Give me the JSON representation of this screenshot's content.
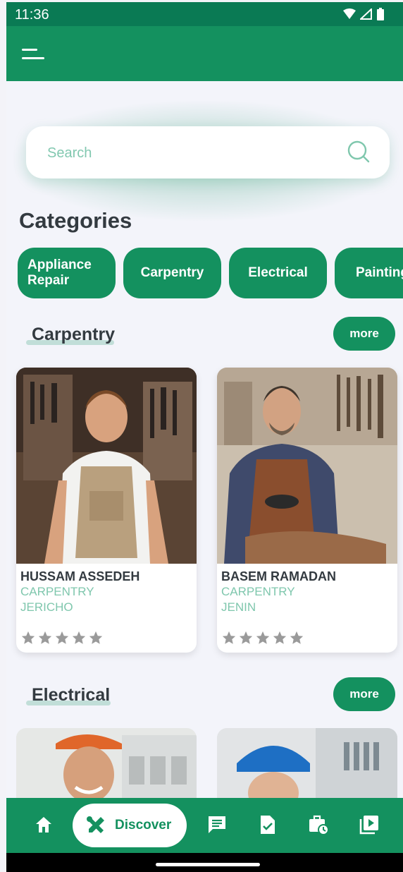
{
  "status": {
    "time": "11:36"
  },
  "search": {
    "placeholder": "Search"
  },
  "categories": {
    "title": "Categories",
    "items": [
      "Appliance Repair",
      "Carpentry",
      "Electrical",
      "Painting"
    ]
  },
  "sections": [
    {
      "title": "Carpentry",
      "more_label": "more",
      "cards": [
        {
          "name": "HUSSAM ASSEDEH",
          "category": "CARPENTRY",
          "city": "JERICHO",
          "rating": 0
        },
        {
          "name": "BASEM RAMADAN",
          "category": "CARPENTRY",
          "city": "JENIN",
          "rating": 0
        }
      ]
    },
    {
      "title": "Electrical",
      "more_label": "more"
    }
  ],
  "bottom_nav": {
    "active_label": "Discover",
    "items": [
      "home-icon",
      "discover-tools-icon",
      "chat-icon",
      "task-done-icon",
      "schedule-case-icon",
      "video-library-icon"
    ]
  },
  "colors": {
    "primary": "#14915f",
    "status_bar": "#0a7a54",
    "accent_text": "#7fc7ad",
    "star": "#9a9a9a"
  }
}
